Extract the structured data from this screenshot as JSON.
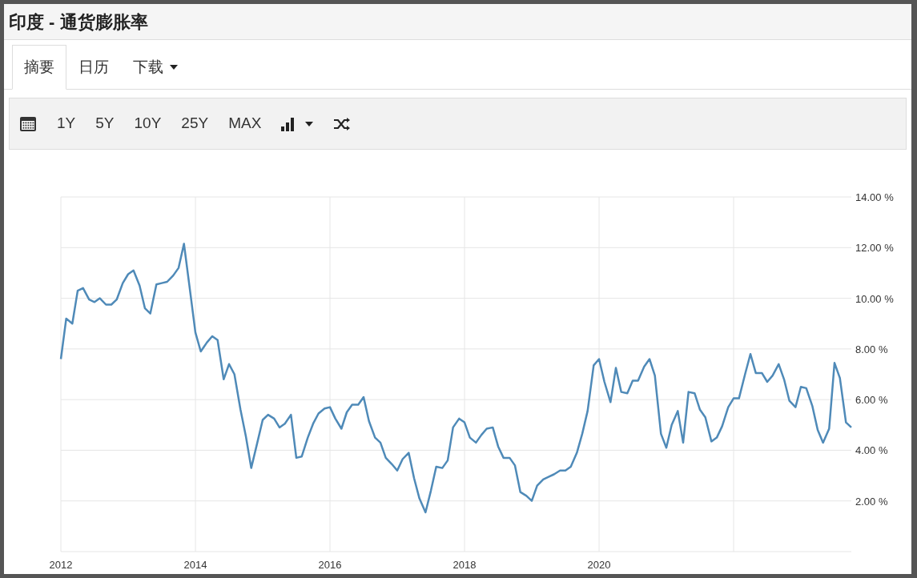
{
  "title": "印度 - 通货膨胀率",
  "tabs": [
    {
      "label": "摘要",
      "selected": true,
      "kind": "tab"
    },
    {
      "label": "日历",
      "selected": false,
      "kind": "tab"
    },
    {
      "label": "下载",
      "selected": false,
      "kind": "dropdown"
    }
  ],
  "ranges": [
    "1Y",
    "5Y",
    "10Y",
    "25Y",
    "MAX"
  ],
  "chart_data": {
    "type": "line",
    "x": [
      2012,
      2012.08,
      2012.17,
      2012.25,
      2012.33,
      2012.42,
      2012.5,
      2012.58,
      2012.67,
      2012.75,
      2012.83,
      2012.92,
      2013,
      2013.08,
      2013.17,
      2013.25,
      2013.33,
      2013.42,
      2013.5,
      2013.58,
      2013.67,
      2013.75,
      2013.83,
      2013.92,
      2014,
      2014.08,
      2014.17,
      2014.25,
      2014.33,
      2014.42,
      2014.5,
      2014.58,
      2014.67,
      2014.75,
      2014.83,
      2014.92,
      2015,
      2015.08,
      2015.17,
      2015.25,
      2015.33,
      2015.42,
      2015.5,
      2015.58,
      2015.67,
      2015.75,
      2015.83,
      2015.92,
      2016,
      2016.08,
      2016.17,
      2016.25,
      2016.33,
      2016.42,
      2016.5,
      2016.58,
      2016.67,
      2016.75,
      2016.83,
      2016.92,
      2017,
      2017.08,
      2017.17,
      2017.25,
      2017.33,
      2017.42,
      2017.5,
      2017.58,
      2017.67,
      2017.75,
      2017.83,
      2017.92,
      2018,
      2018.08,
      2018.17,
      2018.25,
      2018.33,
      2018.42,
      2018.5,
      2018.58,
      2018.67,
      2018.75,
      2018.83,
      2018.92,
      2019,
      2019.08,
      2019.17,
      2019.25,
      2019.33,
      2019.42,
      2019.5,
      2019.58,
      2019.67,
      2019.75,
      2019.83,
      2019.92,
      2020,
      2020.08,
      2020.17,
      2020.25,
      2020.33,
      2020.42,
      2020.5,
      2020.58,
      2020.67,
      2020.75,
      2020.83,
      2020.92,
      2021,
      2021.08,
      2021.17,
      2021.25,
      2021.33,
      2021.42,
      2021.5,
      2021.58,
      2021.67,
      2021.75,
      2021.83,
      2021.92,
      2022,
      2022.08,
      2022.17,
      2022.25,
      2022.33,
      2022.42,
      2022.5,
      2022.58,
      2022.67,
      2022.75,
      2022.83,
      2022.92,
      2023,
      2023.08,
      2023.17,
      2023.25,
      2023.33,
      2023.42,
      2023.5,
      2023.58,
      2023.67,
      2023.75
    ],
    "series": [
      {
        "color": "#4f8ab8",
        "values": [
          7.6,
          9.2,
          9.0,
          10.3,
          10.4,
          9.95,
          9.85,
          10.0,
          9.75,
          9.75,
          9.95,
          10.6,
          10.95,
          11.1,
          10.5,
          9.6,
          9.4,
          10.55,
          10.6,
          10.65,
          10.9,
          11.2,
          12.15,
          10.3,
          8.65,
          7.9,
          8.25,
          8.5,
          8.35,
          6.8,
          7.4,
          7.0,
          5.6,
          4.55,
          3.3,
          4.3,
          5.2,
          5.4,
          5.25,
          4.9,
          5.05,
          5.4,
          3.7,
          3.75,
          4.5,
          5.05,
          5.45,
          5.65,
          5.7,
          5.25,
          4.85,
          5.5,
          5.8,
          5.8,
          6.1,
          5.15,
          4.5,
          4.3,
          3.7,
          3.45,
          3.2,
          3.65,
          3.9,
          2.9,
          2.1,
          1.55,
          2.4,
          3.35,
          3.3,
          3.6,
          4.9,
          5.25,
          5.1,
          4.5,
          4.3,
          4.6,
          4.85,
          4.9,
          4.15,
          3.7,
          3.7,
          3.4,
          2.35,
          2.2,
          2.0,
          2.6,
          2.85,
          2.95,
          3.05,
          3.2,
          3.2,
          3.35,
          3.9,
          4.65,
          5.55,
          7.35,
          7.6,
          6.7,
          5.9,
          7.25,
          6.3,
          6.25,
          6.75,
          6.75,
          7.3,
          7.6,
          6.95,
          4.65,
          4.1,
          5.0,
          5.55,
          4.3,
          6.3,
          6.25,
          5.6,
          5.3,
          4.35,
          4.5,
          4.95,
          5.7,
          6.05,
          6.05,
          7.0,
          7.8,
          7.05,
          7.05,
          6.7,
          6.95,
          7.4,
          6.8,
          5.95,
          5.7,
          6.5,
          6.45,
          5.75,
          4.8,
          4.3,
          4.85,
          7.45,
          6.85,
          5.1,
          4.9
        ]
      }
    ],
    "xlim": [
      2012,
      2023.75
    ],
    "ylim": [
      0,
      14
    ],
    "grid": true,
    "xticks": [
      2012,
      2014,
      2016,
      2018,
      2020
    ],
    "yticks": [
      {
        "value": 2,
        "label": "2.00 %"
      },
      {
        "value": 4,
        "label": "4.00 %"
      },
      {
        "value": 6,
        "label": "6.00 %"
      },
      {
        "value": 8,
        "label": "8.00 %"
      },
      {
        "value": 10,
        "label": "10.00 %"
      },
      {
        "value": 12,
        "label": "12.00 %"
      },
      {
        "value": 14,
        "label": "14.00 %"
      }
    ]
  }
}
